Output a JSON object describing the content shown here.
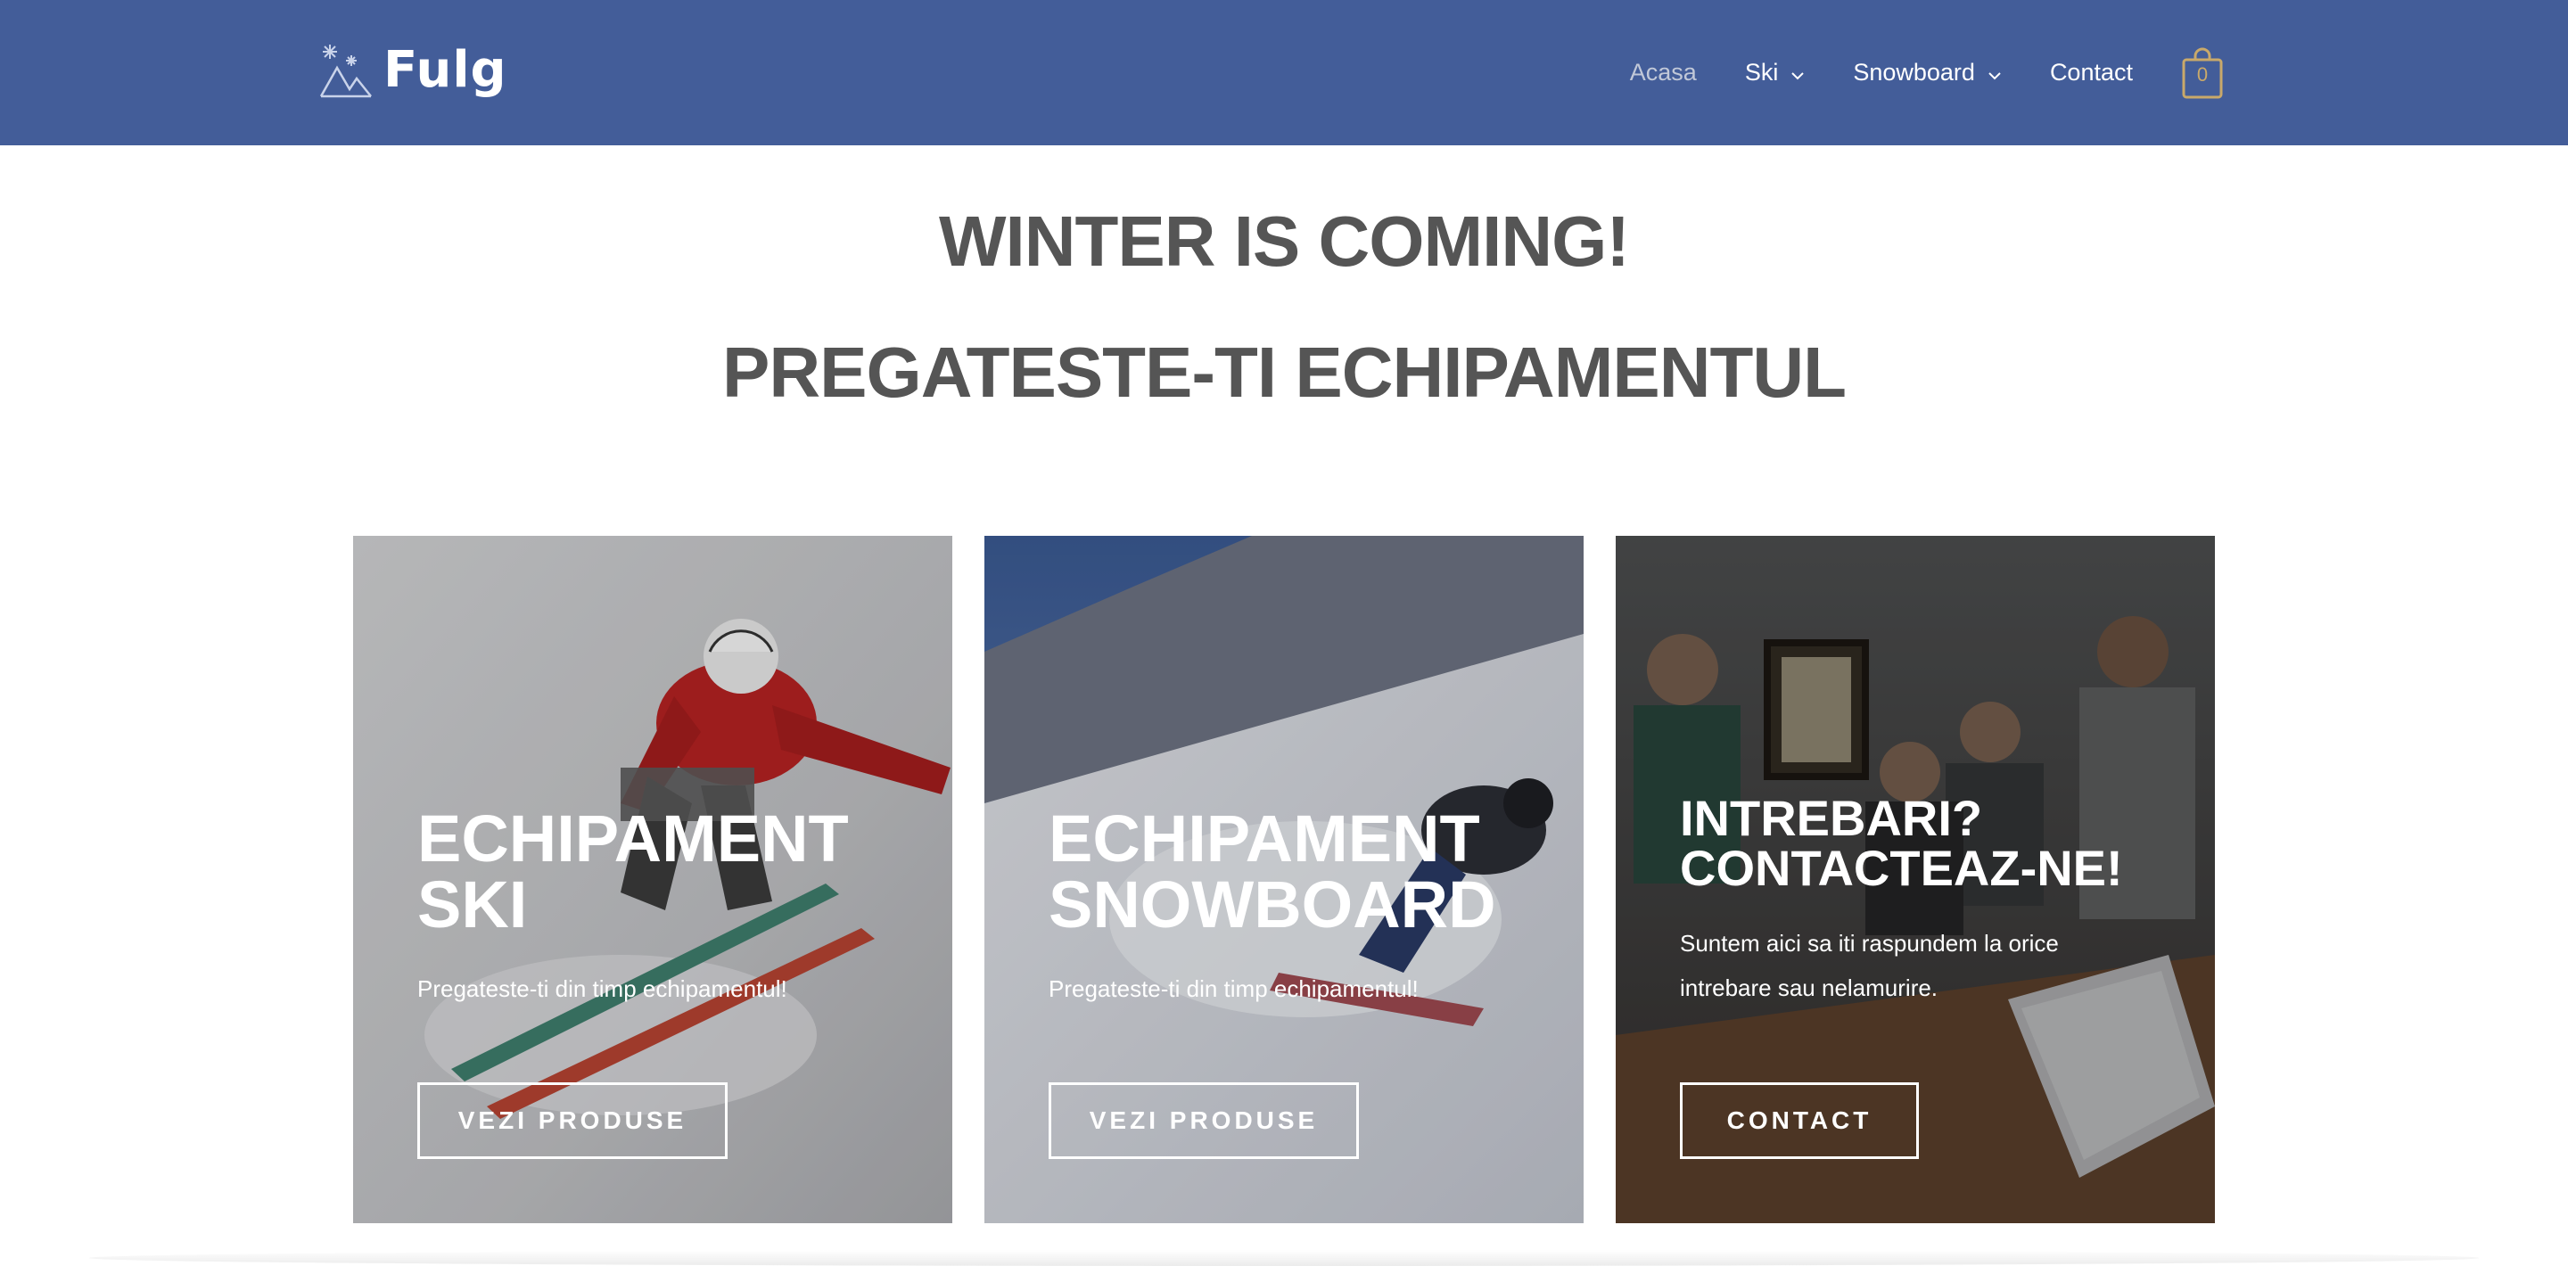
{
  "header": {
    "logo_text": "Fulg",
    "bg_color": "#435d99",
    "nav": [
      {
        "label": "Acasa",
        "active": true
      },
      {
        "label": "Ski",
        "dropdown": true
      },
      {
        "label": "Snowboard",
        "dropdown": true
      },
      {
        "label": "Contact"
      }
    ],
    "cart_count": "0"
  },
  "hero": {
    "title": "WINTER IS COMING!",
    "subtitle": "PREGATESTE-TI ECHIPAMENTUL"
  },
  "cards": [
    {
      "title_line1": "ECHIPAMENT",
      "title_line2": "SKI",
      "text": "Pregateste-ti din timp echipamentul!",
      "button": "VEZI PRODUSE"
    },
    {
      "title_line1": "ECHIPAMENT",
      "title_line2": "SNOWBOARD",
      "text": "Pregateste-ti din timp echipamentul!",
      "button": "VEZI PRODUSE"
    },
    {
      "title_line1": "INTREBARI?",
      "title_line2": "CONTACTEAZ-NE!",
      "text_line1": "Suntem aici sa iti raspundem la orice",
      "text_line2": "intrebare sau nelamurire.",
      "button": "CONTACT"
    }
  ]
}
